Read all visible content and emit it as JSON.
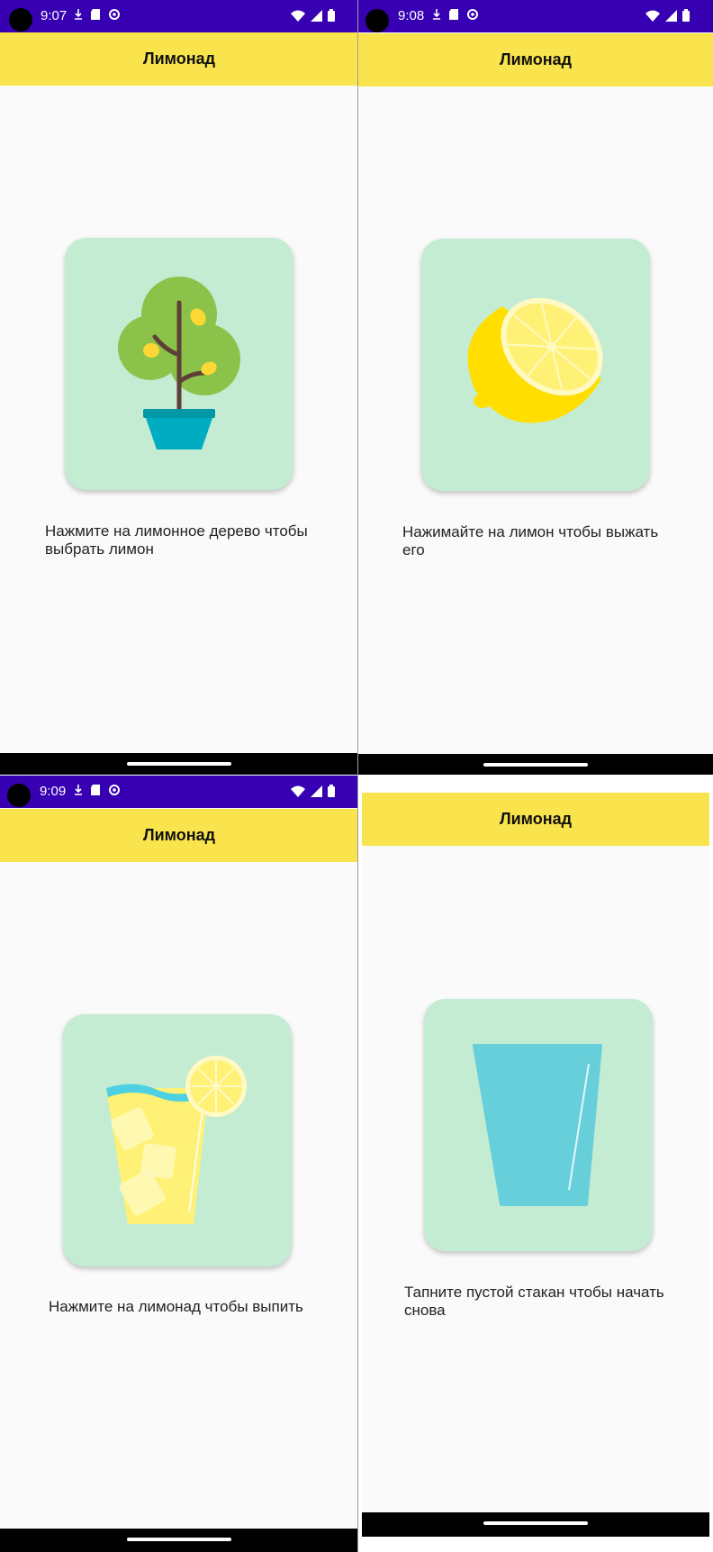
{
  "screens": [
    {
      "status": {
        "time": "9:07"
      },
      "app_title": "Лимонад",
      "image_icon": "lemon-tree-icon",
      "instruction": "Нажмите на лимонное дерево чтобы выбрать лимон"
    },
    {
      "status": {
        "time": "9:08"
      },
      "app_title": "Лимонад",
      "image_icon": "lemon-half-icon",
      "instruction": "Нажимайте на лимон чтобы выжать его"
    },
    {
      "status": {
        "time": "9:09"
      },
      "app_title": "Лимонад",
      "image_icon": "lemonade-glass-icon",
      "instruction": "Нажмите на лимонад чтобы выпить"
    },
    {
      "app_title": "Лимонад",
      "image_icon": "empty-glass-icon",
      "instruction": "Тапните пустой стакан чтобы начать снова"
    }
  ],
  "colors": {
    "status_bar": "#3700b3",
    "app_bar": "#fae44d",
    "card": "#c3ecd3",
    "background": "#fafafa"
  }
}
